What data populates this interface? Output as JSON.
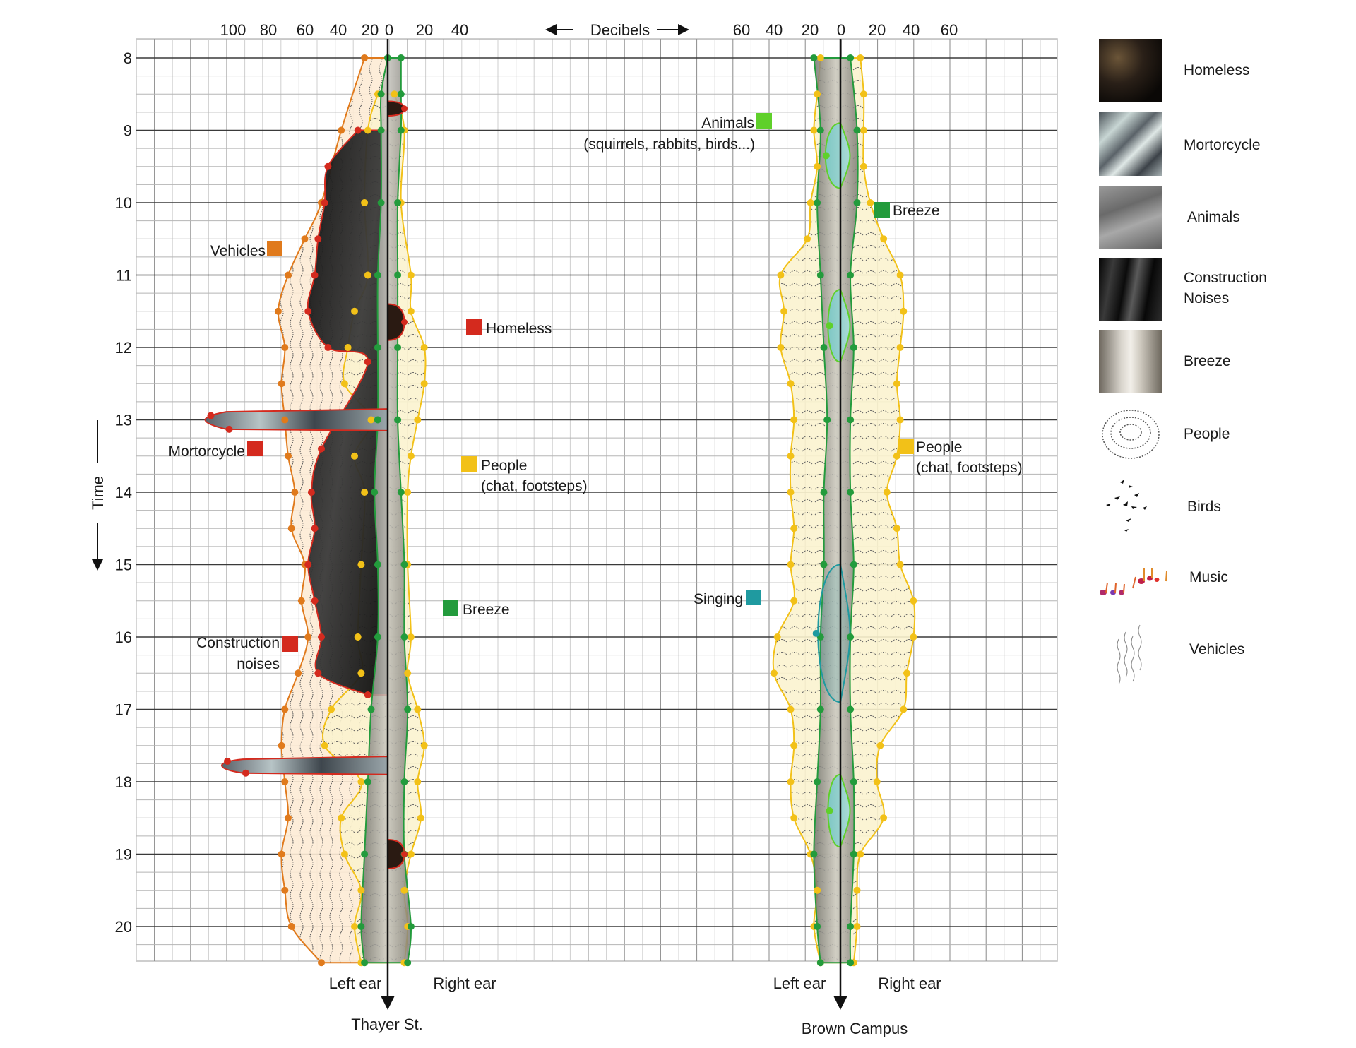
{
  "chart_data": {
    "type": "area",
    "title": "",
    "xlabel": "Decibels",
    "ylabel": "Time",
    "y_axis": {
      "label": "Time",
      "direction": "down",
      "range": [
        7.7,
        20.5
      ],
      "ticks": [
        8,
        9,
        10,
        11,
        12,
        13,
        14,
        15,
        16,
        17,
        18,
        19,
        20
      ]
    },
    "x_axis_header": "Decibels",
    "grid": true,
    "panels": [
      {
        "name": "Thayer St.",
        "left_label": "Left ear",
        "right_label": "Right ear",
        "x_tick_labels_left": [
          "100",
          "80",
          "60",
          "40",
          "20"
        ],
        "x_tick_labels_center": "0",
        "x_tick_labels_right": [
          "20",
          "40"
        ],
        "series": [
          {
            "name": "Vehicles",
            "color": "#e07a1c",
            "time": [
              8,
              9,
              10,
              10.5,
              11,
              11.5,
              12,
              12.5,
              13,
              13.5,
              14,
              14.5,
              15,
              15.5,
              16,
              16.5,
              17,
              17.5,
              18,
              18.5,
              19,
              19.5,
              20,
              20.5
            ],
            "left_db": [
              14,
              28,
              40,
              50,
              60,
              66,
              62,
              64,
              62,
              60,
              56,
              58,
              50,
              52,
              48,
              54,
              62,
              64,
              62,
              60,
              64,
              62,
              58,
              40
            ],
            "right_db": [
              0,
              0,
              0,
              0,
              0,
              0,
              0,
              0,
              0,
              0,
              0,
              0,
              0,
              0,
              0,
              0,
              0,
              0,
              0,
              0,
              0,
              0,
              0,
              0
            ]
          },
          {
            "name": "Construction noises",
            "color": "#d42a1e",
            "time": [
              9,
              9.5,
              10,
              10.5,
              11,
              11.5,
              12,
              12.2,
              13.4,
              14,
              14.5,
              15,
              15.5,
              16,
              16.5,
              16.8
            ],
            "left_db": [
              18,
              36,
              38,
              42,
              44,
              48,
              36,
              12,
              40,
              46,
              44,
              48,
              44,
              40,
              42,
              12
            ],
            "right_db": [
              0,
              0,
              0,
              0,
              0,
              0,
              0,
              0,
              0,
              0,
              0,
              0,
              0,
              0,
              0,
              0
            ]
          },
          {
            "name": "Mortorcycle",
            "color": "#d42a1e",
            "events": [
              {
                "time_start": 12.85,
                "time_end": 13.15,
                "peak_left_db": 110
              },
              {
                "time_start": 17.65,
                "time_end": 17.9,
                "peak_left_db": 100
              }
            ]
          },
          {
            "name": "Homeless",
            "color": "#d42a1e",
            "events": [
              {
                "time_start": 8.6,
                "time_end": 8.8,
                "right_db": 10
              },
              {
                "time_start": 11.4,
                "time_end": 11.9,
                "right_db": 10
              },
              {
                "time_start": 18.8,
                "time_end": 19.2,
                "right_db": 10
              }
            ]
          },
          {
            "name": "People (chat, footsteps)",
            "color": "#f2c118",
            "time": [
              8.5,
              9,
              10,
              11,
              11.5,
              12,
              12.5,
              13,
              13.5,
              14,
              15,
              16,
              16.5,
              17,
              17.5,
              18,
              18.5,
              19,
              19.5,
              20,
              20.5
            ],
            "left_db": [
              6,
              12,
              14,
              12,
              20,
              24,
              26,
              10,
              20,
              14,
              16,
              18,
              16,
              34,
              38,
              16,
              28,
              26,
              16,
              20,
              16
            ],
            "right_db": [
              4,
              10,
              8,
              14,
              14,
              22,
              22,
              18,
              14,
              12,
              12,
              14,
              12,
              18,
              22,
              18,
              20,
              14,
              10,
              12,
              10
            ]
          },
          {
            "name": "Breeze",
            "color": "#239b3c",
            "time": [
              8,
              8.5,
              9,
              10,
              11,
              12,
              13,
              14,
              15,
              16,
              17,
              18,
              19,
              20,
              20.5
            ],
            "left_db": [
              0,
              4,
              4,
              4,
              6,
              6,
              6,
              8,
              6,
              6,
              10,
              12,
              14,
              16,
              14
            ],
            "right_db": [
              8,
              8,
              8,
              6,
              6,
              6,
              6,
              8,
              10,
              10,
              12,
              10,
              10,
              14,
              12
            ]
          }
        ]
      },
      {
        "name": "Brown Campus",
        "left_label": "Left ear",
        "right_label": "Right ear",
        "x_tick_labels_left": [
          "60",
          "40",
          "20"
        ],
        "x_tick_labels_center": "0",
        "x_tick_labels_right": [
          "20",
          "40",
          "60"
        ],
        "series": [
          {
            "name": "People (chat, footsteps)",
            "color": "#f2c118",
            "time": [
              8,
              8.5,
              9,
              9.5,
              10,
              10.5,
              11,
              11.5,
              12,
              12.5,
              13,
              13.5,
              14,
              14.5,
              15,
              15.5,
              16,
              16.5,
              17,
              17.5,
              18,
              18.5,
              19,
              19.5,
              20,
              20.5
            ],
            "left_db": [
              12,
              14,
              16,
              14,
              18,
              20,
              36,
              34,
              36,
              30,
              28,
              30,
              30,
              28,
              30,
              28,
              38,
              40,
              30,
              28,
              30,
              28,
              18,
              14,
              16,
              12
            ],
            "right_db": [
              12,
              14,
              14,
              14,
              18,
              26,
              36,
              38,
              36,
              34,
              36,
              34,
              28,
              34,
              36,
              44,
              44,
              40,
              38,
              24,
              22,
              26,
              12,
              10,
              10,
              8
            ]
          },
          {
            "name": "Breeze",
            "color": "#239b3c",
            "time": [
              8,
              9,
              10,
              11,
              12,
              13,
              14,
              15,
              16,
              17,
              18,
              19,
              20,
              20.5
            ],
            "left_db": [
              16,
              12,
              14,
              12,
              10,
              8,
              10,
              10,
              12,
              12,
              14,
              16,
              14,
              12
            ],
            "right_db": [
              6,
              10,
              10,
              6,
              8,
              6,
              6,
              8,
              6,
              6,
              8,
              8,
              6,
              6
            ]
          },
          {
            "name": "Animals (squirrels, rabbits, birds...)",
            "color": "#5fd02a",
            "events": [
              {
                "time_start": 8.9,
                "time_end": 9.8,
                "left_db": 12
              },
              {
                "time_start": 11.2,
                "time_end": 12.2,
                "left_db": 10
              },
              {
                "time_start": 17.9,
                "time_end": 18.9,
                "left_db": 10
              }
            ]
          },
          {
            "name": "Singing",
            "color": "#1f9aa0",
            "events": [
              {
                "time_start": 15.0,
                "time_end": 16.9,
                "left_db": 18
              }
            ]
          }
        ]
      }
    ]
  },
  "axis": {
    "time_label": "Time",
    "decibels_label": "Decibels",
    "hours": [
      "8",
      "9",
      "10",
      "11",
      "12",
      "13",
      "14",
      "15",
      "16",
      "17",
      "18",
      "19",
      "20"
    ],
    "thayer_ticks": [
      "100",
      "80",
      "60",
      "40",
      "20",
      "0",
      "20",
      "40"
    ],
    "brown_ticks": [
      "60",
      "40",
      "20",
      "0",
      "20",
      "40",
      "60"
    ]
  },
  "panels": {
    "thayer": {
      "name": "Thayer St.",
      "left_ear": "Left ear",
      "right_ear": "Right ear"
    },
    "brown": {
      "name": "Brown Campus",
      "left_ear": "Left ear",
      "right_ear": "Right ear"
    }
  },
  "annotations": {
    "vehicles": {
      "label": "Vehicles",
      "color": "#e07a1c"
    },
    "homeless": {
      "label": "Homeless",
      "color": "#d42a1e"
    },
    "mortorcycle": {
      "label": "Mortorcycle",
      "color": "#d42a1e"
    },
    "people_thayer": {
      "line1": "People",
      "line2": "(chat, footsteps)",
      "color": "#f2c118"
    },
    "breeze_thayer": {
      "label": "Breeze",
      "color": "#239b3c"
    },
    "construction": {
      "line1": "Construction",
      "line2": "noises",
      "color": "#d42a1e"
    },
    "animals": {
      "line1": "Animals",
      "line2": "(squirrels, rabbits, birds...)",
      "color": "#5fd02a"
    },
    "breeze_brown": {
      "label": "Breeze",
      "color": "#239b3c"
    },
    "people_brown": {
      "line1": "People",
      "line2": "(chat, footsteps)",
      "color": "#f2c118"
    },
    "singing": {
      "label": "Singing",
      "color": "#1f9aa0"
    }
  },
  "legend": {
    "items": [
      {
        "label": "Homeless",
        "icon": "dark-hair-texture"
      },
      {
        "label": "Mortorcycle",
        "icon": "water-reflection-texture"
      },
      {
        "label": "Animals",
        "icon": "grey-smoke-texture"
      },
      {
        "label": "Construction\nNoises",
        "icon": "black-marble-texture"
      },
      {
        "label": "Breeze",
        "icon": "feather-texture"
      },
      {
        "label": "People",
        "icon": "text-spiral-icon"
      },
      {
        "label": "Birds",
        "icon": "birds-icon"
      },
      {
        "label": "Music",
        "icon": "music-notes-icon"
      },
      {
        "label": "Vehicles",
        "icon": "wavy-lines-icon"
      }
    ]
  }
}
